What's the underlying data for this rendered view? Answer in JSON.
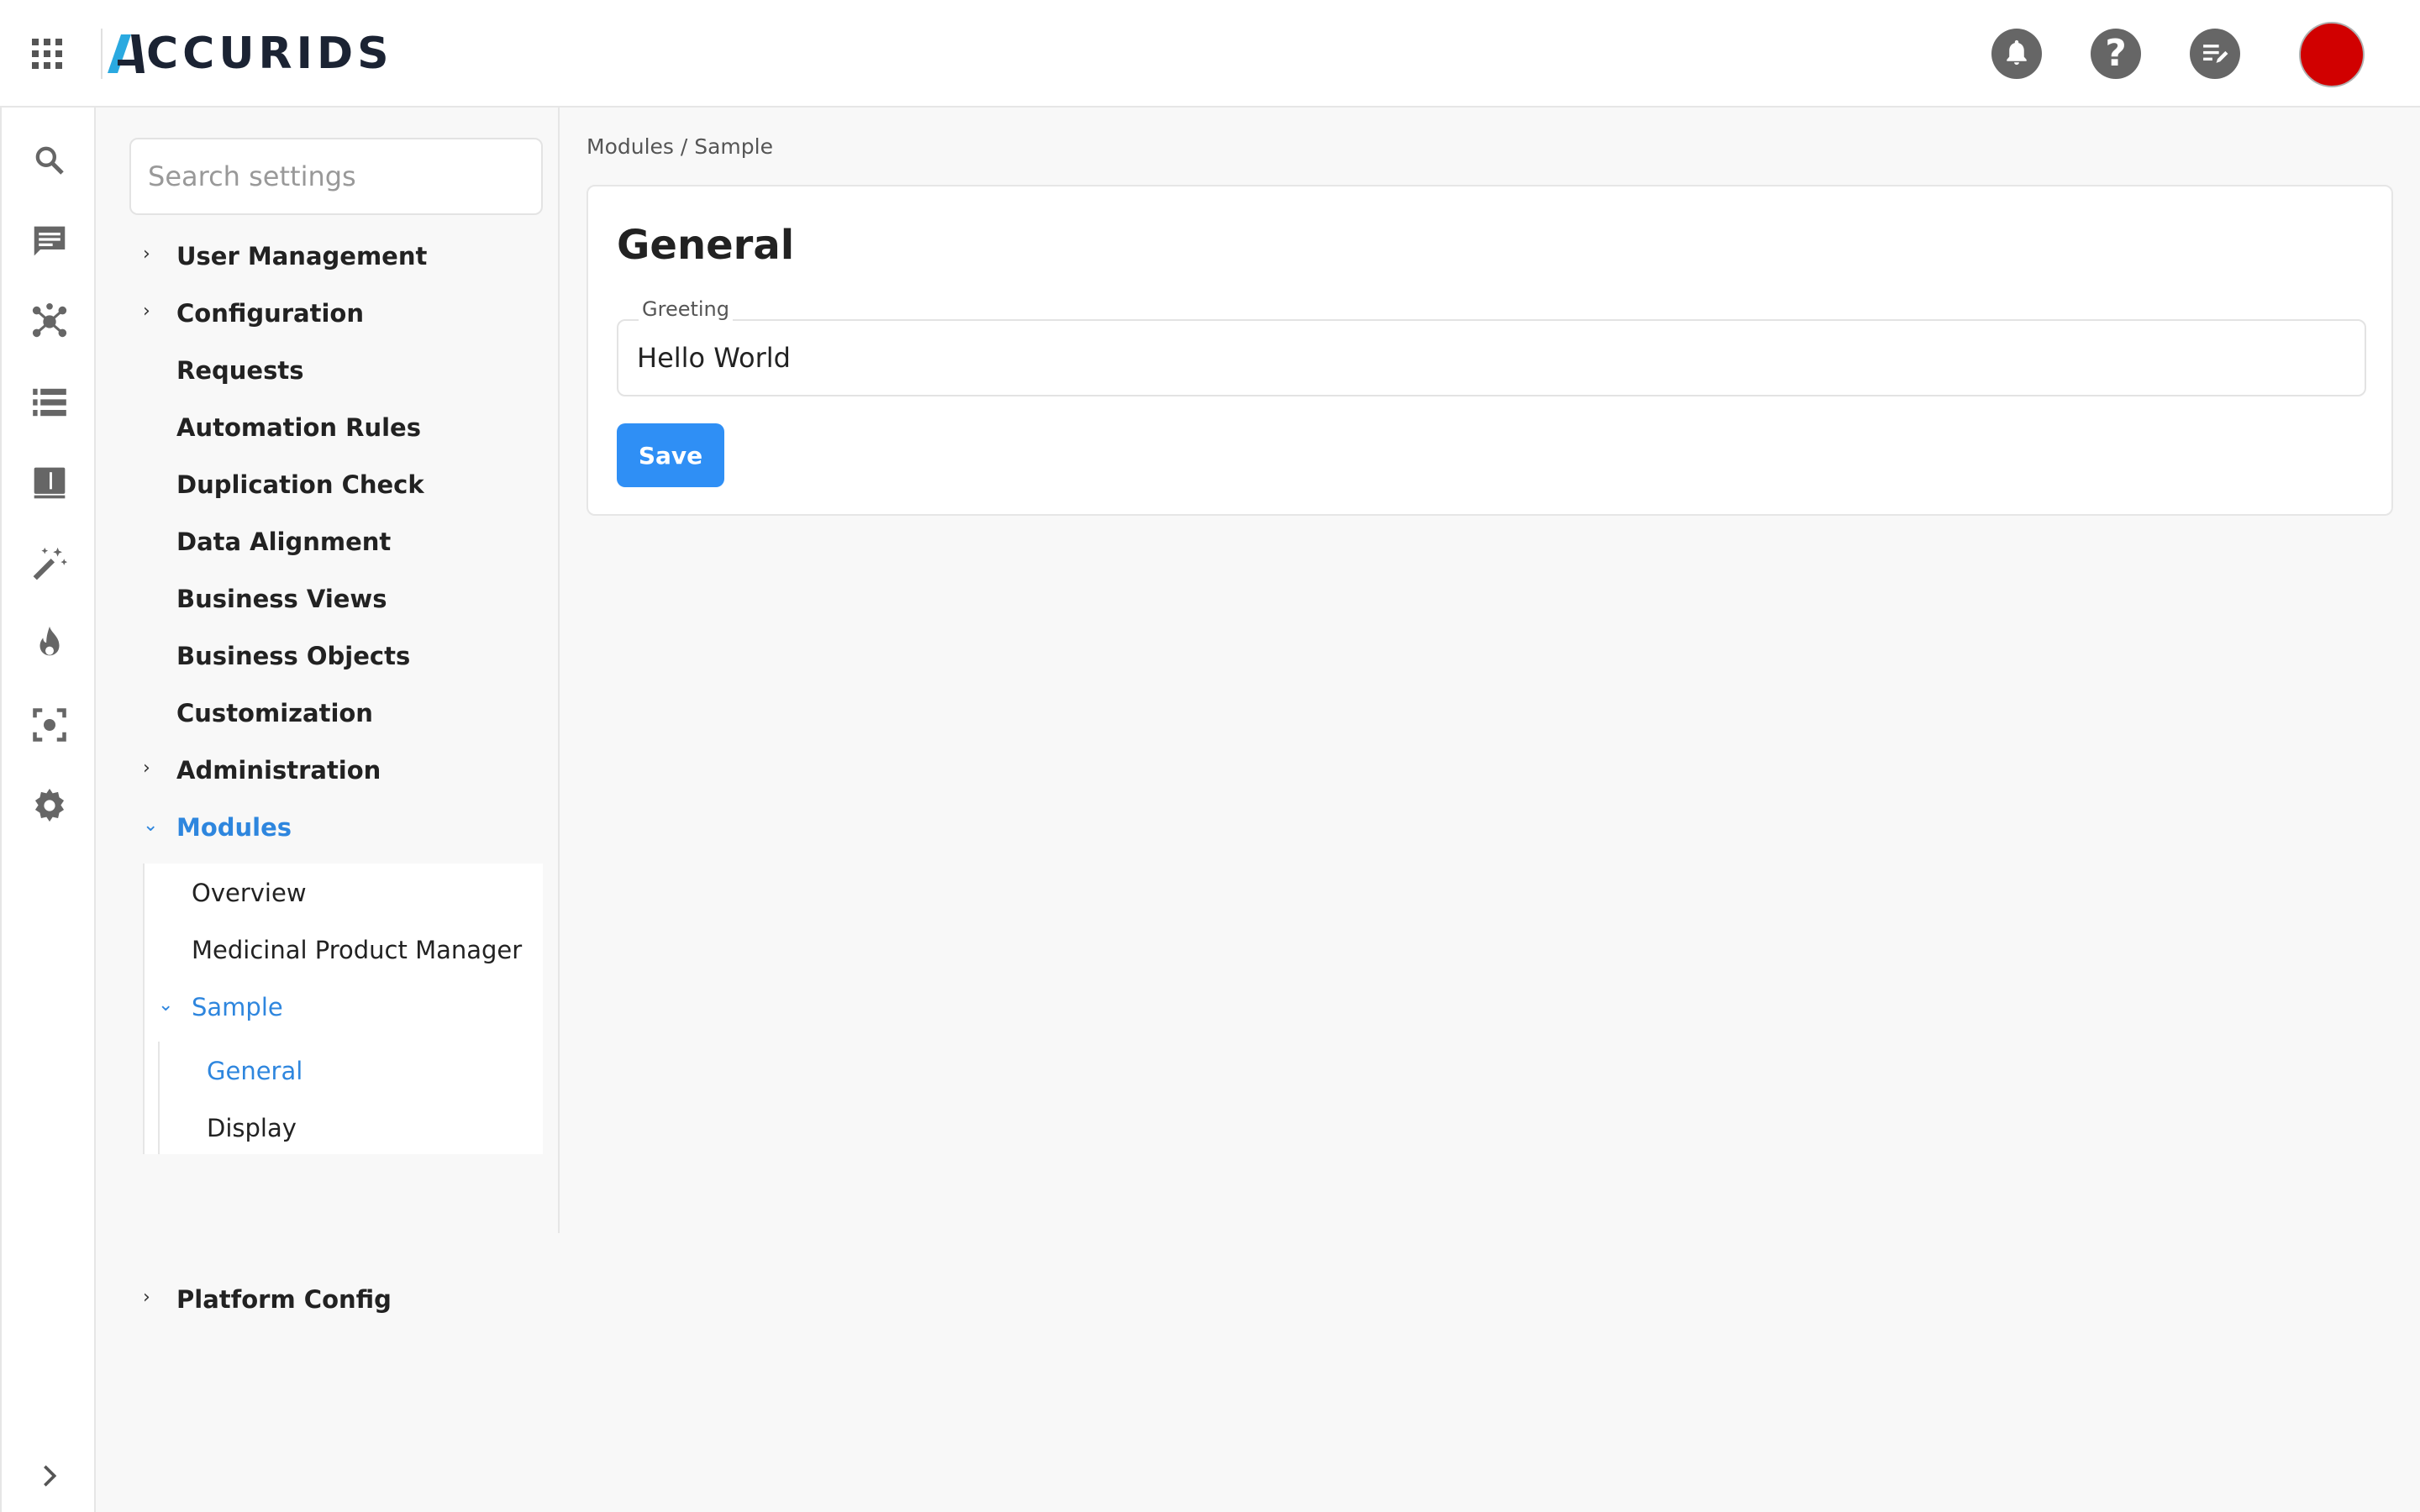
{
  "header": {
    "logo_text": "ACCURIDS",
    "icons": [
      "apps-grid-icon",
      "notification-bell-icon",
      "help-icon",
      "edit-notes-icon"
    ],
    "avatar_color": "#d10000"
  },
  "rail": {
    "icons": [
      "search-icon",
      "chat-icon",
      "network-icon",
      "list-icon",
      "dictionary-icon",
      "magic-wand-icon",
      "fire-icon",
      "scan-focus-icon",
      "gear-icon"
    ],
    "expand_icon": "chevron-right-icon"
  },
  "nav": {
    "search_placeholder": "Search settings",
    "items": [
      {
        "label": "User Management",
        "expandable": true
      },
      {
        "label": "Configuration",
        "expandable": true
      },
      {
        "label": "Requests",
        "expandable": false
      },
      {
        "label": "Automation Rules",
        "expandable": false
      },
      {
        "label": "Duplication Check",
        "expandable": false
      },
      {
        "label": "Data Alignment",
        "expandable": false
      },
      {
        "label": "Business Views",
        "expandable": false
      },
      {
        "label": "Business Objects",
        "expandable": false
      },
      {
        "label": "Customization",
        "expandable": false
      },
      {
        "label": "Administration",
        "expandable": true
      },
      {
        "label": "Modules",
        "expandable": true,
        "expanded": true
      },
      {
        "label": "Platform Config",
        "expandable": true
      }
    ],
    "modules_children": [
      "Overview",
      "Medicinal Product Manager",
      "Sample"
    ],
    "sample_children": [
      "General",
      "Display"
    ]
  },
  "breadcrumb": "Modules / Sample",
  "main": {
    "title": "General",
    "greeting_label": "Greeting",
    "greeting_value": "Hello World",
    "save_label": "Save"
  },
  "colors": {
    "accent": "#2e86de",
    "primary_button": "#2f8ff5"
  }
}
